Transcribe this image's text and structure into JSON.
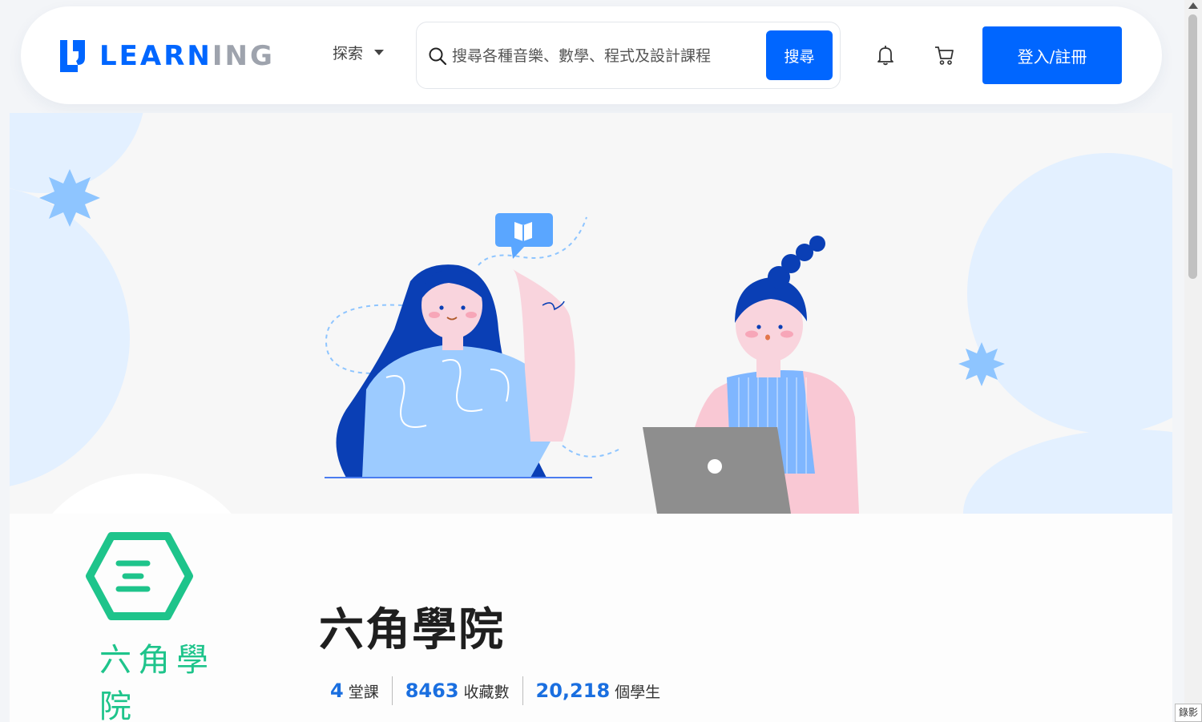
{
  "header": {
    "logo": {
      "brand_blue": "LEARN",
      "brand_gray": "ING"
    },
    "explore_label": "探索",
    "search": {
      "placeholder": "搜尋各種音樂、數學、程式及設計課程",
      "button_label": "搜尋"
    },
    "icons": [
      "search-icon",
      "bell-icon",
      "cart-icon"
    ],
    "login_label": "登入/註冊"
  },
  "school": {
    "logo_text": "六角學院",
    "name": "六角學院",
    "stats": [
      {
        "value": "4",
        "label": "堂課"
      },
      {
        "value": "8463",
        "label": "收藏數"
      },
      {
        "value": "20,218",
        "label": "個學生"
      }
    ]
  },
  "corner_tag": "錄影",
  "colors": {
    "accent": "#0066ff",
    "brand_gray": "#9ea3ad",
    "school_green": "#1ec48b",
    "stat_blue": "#1a6fe0",
    "banner_bg": "#f7f7f7",
    "illustration_dark_blue": "#0a3fb5",
    "illustration_light_blue": "#8ec5ff",
    "illustration_pink": "#f9c8d4"
  }
}
